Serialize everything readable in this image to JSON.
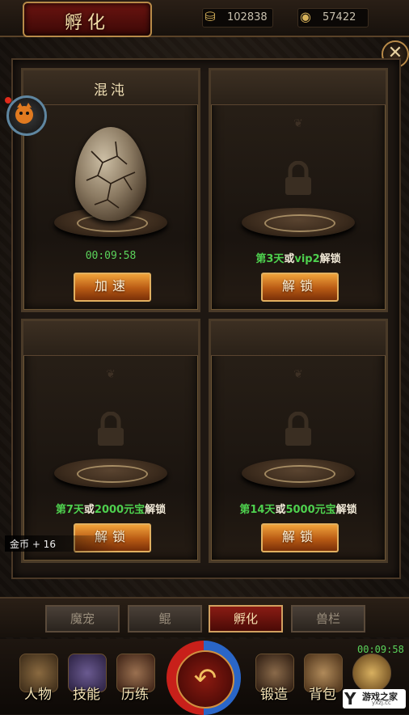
{
  "header": {
    "title": "孵化",
    "resource1_value": "102838",
    "resource2_value": "57422",
    "resource1_icon": "ingot-icon",
    "resource2_icon": "coin-icon"
  },
  "slots": [
    {
      "title": "混沌",
      "timer": "00:09:58",
      "button": "加速",
      "locked": false
    },
    {
      "title": "",
      "unlock_pre": "第3天",
      "unlock_or": "或",
      "unlock_cond": "vip2",
      "unlock_suf": "解锁",
      "button": "解锁",
      "locked": true
    },
    {
      "title": "",
      "unlock_pre": "第7天",
      "unlock_or": "或",
      "unlock_cond": "2000元宝",
      "unlock_suf": "解锁",
      "button": "解锁",
      "locked": true
    },
    {
      "title": "",
      "unlock_pre": "第14天",
      "unlock_or": "或",
      "unlock_cond": "5000元宝",
      "unlock_suf": "解锁",
      "button": "解锁",
      "locked": true
    }
  ],
  "toast": "金币 + 16",
  "tabs": [
    {
      "label": "魔宠",
      "active": false
    },
    {
      "label": "鲲",
      "active": false
    },
    {
      "label": "孵化",
      "active": true
    },
    {
      "label": "兽栏",
      "active": false
    }
  ],
  "bottom_menu": [
    {
      "label": "人物",
      "icon": "helmet-icon"
    },
    {
      "label": "技能",
      "icon": "book-icon"
    },
    {
      "label": "历练",
      "icon": "sword-icon"
    },
    {
      "label": "锻造",
      "icon": "anvil-icon"
    },
    {
      "label": "背包",
      "icon": "bag-icon"
    }
  ],
  "bottom_timer": "00:09:58",
  "watermark": {
    "name": "游戏之家",
    "url": "yxzj.cc"
  },
  "colors": {
    "accent": "#b88a48",
    "timer_green": "#5bd35b",
    "button_orange": "#d87a20",
    "active_tab": "#8a1c14"
  }
}
